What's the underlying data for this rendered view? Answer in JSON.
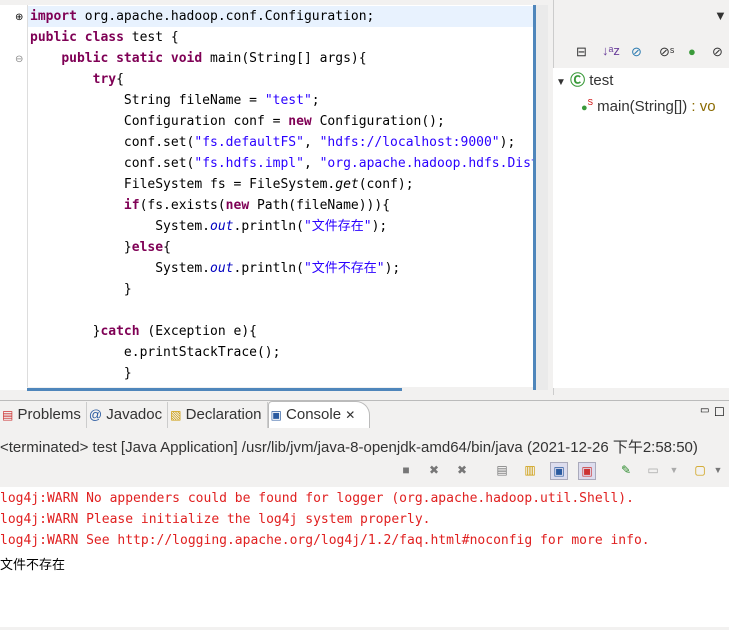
{
  "editor": {
    "lines": [
      [
        {
          "t": "import",
          "c": "kw"
        },
        {
          "t": " org.apache.hadoop.conf.Configuration;"
        }
      ],
      [
        {
          "t": "public",
          "c": "kw"
        },
        {
          "t": " "
        },
        {
          "t": "class",
          "c": "kw"
        },
        {
          "t": " test {"
        }
      ],
      [
        {
          "t": "    "
        },
        {
          "t": "public",
          "c": "kw"
        },
        {
          "t": " "
        },
        {
          "t": "static",
          "c": "kw"
        },
        {
          "t": " "
        },
        {
          "t": "void",
          "c": "kw"
        },
        {
          "t": " main(String[] args){"
        }
      ],
      [
        {
          "t": "        "
        },
        {
          "t": "try",
          "c": "kw"
        },
        {
          "t": "{"
        }
      ],
      [
        {
          "t": "            String fileName = "
        },
        {
          "t": "\"test\"",
          "c": "str"
        },
        {
          "t": ";"
        }
      ],
      [
        {
          "t": "            Configuration conf = "
        },
        {
          "t": "new",
          "c": "kw"
        },
        {
          "t": " Configuration();"
        }
      ],
      [
        {
          "t": "            conf.set("
        },
        {
          "t": "\"fs.defaultFS\"",
          "c": "str"
        },
        {
          "t": ", "
        },
        {
          "t": "\"hdfs://localhost:9000\"",
          "c": "str"
        },
        {
          "t": ");"
        }
      ],
      [
        {
          "t": "            conf.set("
        },
        {
          "t": "\"fs.hdfs.impl\"",
          "c": "str"
        },
        {
          "t": ", "
        },
        {
          "t": "\"org.apache.hadoop.hdfs.DistributedFileSystem\"",
          "c": "str"
        },
        {
          "t": ");"
        }
      ],
      [
        {
          "t": "            FileSystem fs = FileSystem."
        },
        {
          "t": "get",
          "c": "sm"
        },
        {
          "t": "(conf);"
        }
      ],
      [
        {
          "t": "            "
        },
        {
          "t": "if",
          "c": "kw"
        },
        {
          "t": "(fs.exists("
        },
        {
          "t": "new",
          "c": "kw"
        },
        {
          "t": " Path(fileName))){"
        }
      ],
      [
        {
          "t": "                System."
        },
        {
          "t": "out",
          "c": "fld"
        },
        {
          "t": ".println("
        },
        {
          "t": "\"文件存在\"",
          "c": "str"
        },
        {
          "t": ");"
        }
      ],
      [
        {
          "t": "            }"
        },
        {
          "t": "else",
          "c": "kw"
        },
        {
          "t": "{"
        }
      ],
      [
        {
          "t": "                System."
        },
        {
          "t": "out",
          "c": "fld"
        },
        {
          "t": ".println("
        },
        {
          "t": "\"文件不存在\"",
          "c": "str"
        },
        {
          "t": ");"
        }
      ],
      [
        {
          "t": "            }"
        }
      ],
      [
        {
          "t": ""
        }
      ],
      [
        {
          "t": "        }"
        },
        {
          "t": "catch",
          "c": "kw"
        },
        {
          "t": " (Exception e){"
        }
      ],
      [
        {
          "t": "            e.printStackTrace();"
        }
      ],
      [
        {
          "t": "            }"
        }
      ]
    ]
  },
  "outline": {
    "class_name": "test",
    "method": "main(String[])",
    "method_ret": " : vo",
    "static_marker": "S"
  },
  "tabs": [
    {
      "label": "Problems"
    },
    {
      "label": "Javadoc"
    },
    {
      "label": "Declaration"
    },
    {
      "label": "Console"
    }
  ],
  "console": {
    "header": "<terminated> test [Java Application] /usr/lib/jvm/java-8-openjdk-amd64/bin/java (2021-12-26 下午2:58:50)",
    "output": [
      {
        "text": "log4j:WARN No appenders could be found for logger (org.apache.hadoop.util.Shell).",
        "color": "#e02020"
      },
      {
        "text": "log4j:WARN Please initialize the log4j system properly.",
        "color": "#e02020"
      },
      {
        "text": "log4j:WARN See http://logging.apache.org/log4j/1.2/faq.html#noconfig for more info.",
        "color": "#e02020"
      },
      {
        "text": "文件不存在",
        "color": "#000000"
      }
    ]
  }
}
